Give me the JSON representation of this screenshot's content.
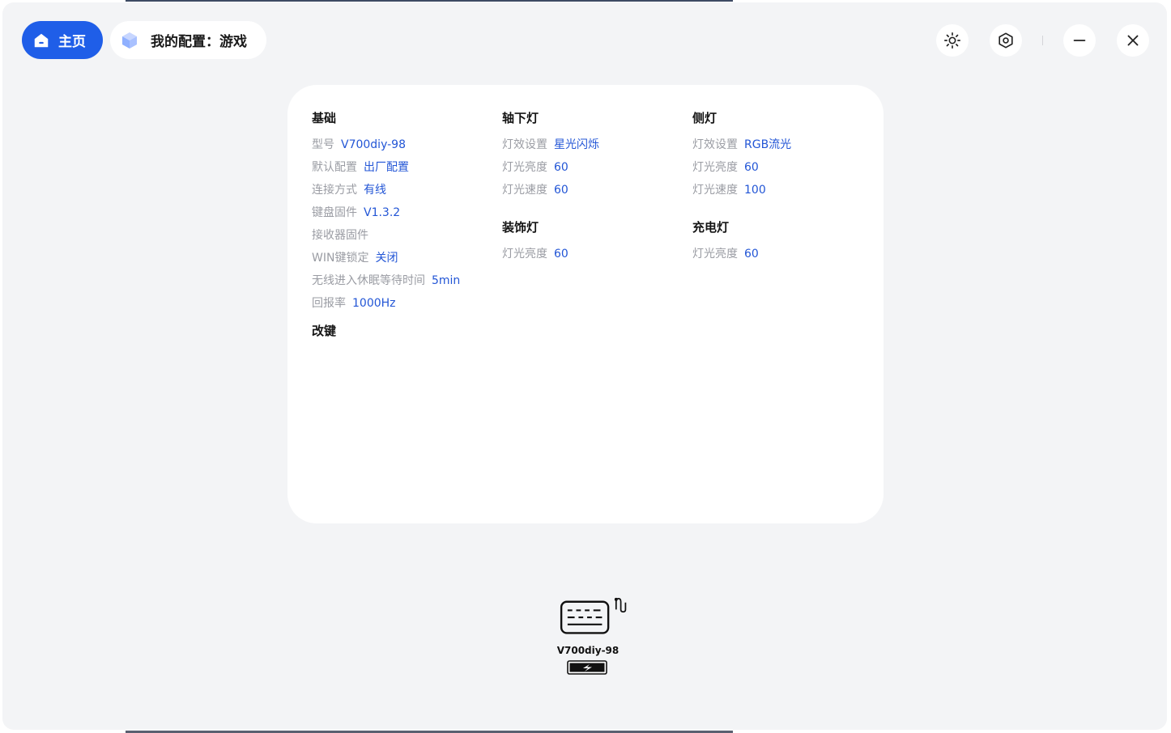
{
  "header": {
    "home_label": "主页",
    "config_label": "我的配置：游戏"
  },
  "controls": {
    "theme_icon": "sun-icon",
    "settings_icon": "hexagon-settings-icon",
    "minimize_icon": "minimize-icon",
    "close_icon": "close-icon"
  },
  "basics": {
    "title": "基础",
    "rows": [
      {
        "label": "型号",
        "value": "V700diy-98"
      },
      {
        "label": "默认配置",
        "value": "出厂配置"
      },
      {
        "label": "连接方式",
        "value": "有线"
      },
      {
        "label": "键盘固件",
        "value": "V1.3.2"
      },
      {
        "label": "接收器固件",
        "value": ""
      },
      {
        "label": "WIN键锁定",
        "value": "关闭"
      },
      {
        "label": "无线进入休眠等待时间",
        "value": "5min"
      },
      {
        "label": "回报率",
        "value": "1000Hz"
      }
    ]
  },
  "remap": {
    "title": "改键"
  },
  "under_light": {
    "title": "轴下灯",
    "rows": [
      {
        "label": "灯效设置",
        "value": "星光闪烁"
      },
      {
        "label": "灯光亮度",
        "value": "60"
      },
      {
        "label": "灯光速度",
        "value": "60"
      }
    ]
  },
  "deco_light": {
    "title": "装饰灯",
    "rows": [
      {
        "label": "灯光亮度",
        "value": "60"
      }
    ]
  },
  "side_light": {
    "title": "侧灯",
    "rows": [
      {
        "label": "灯效设置",
        "value": "RGB流光"
      },
      {
        "label": "灯光亮度",
        "value": "60"
      },
      {
        "label": "灯光速度",
        "value": "100"
      }
    ]
  },
  "charge_light": {
    "title": "充电灯",
    "rows": [
      {
        "label": "灯光亮度",
        "value": "60"
      }
    ]
  },
  "device": {
    "name": "V700diy-98",
    "icon": "keyboard-wired-icon",
    "battery_icon": "battery-charging-icon"
  },
  "colors": {
    "accent": "#1f5ee8",
    "value_text": "#2356d6",
    "label_text": "#9a9ca3",
    "background": "#f3f4f6"
  }
}
